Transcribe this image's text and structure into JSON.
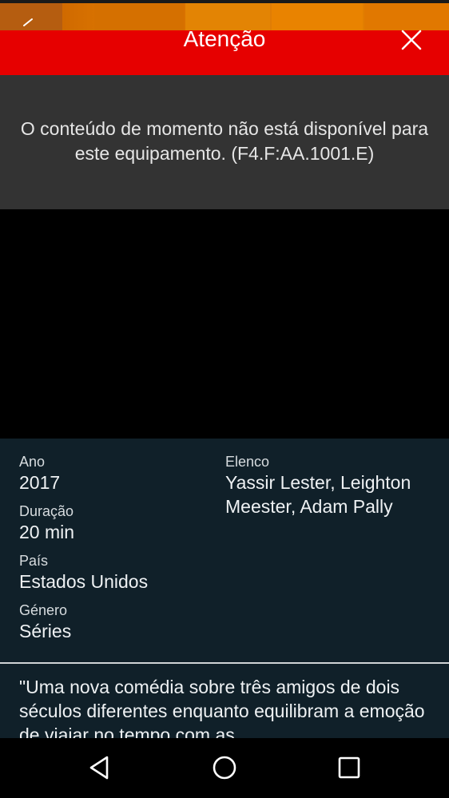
{
  "dialog": {
    "title": "Atenção",
    "message": "O conteúdo de momento não está disponível para este equipamento. (F4.F:AA.1001.E)",
    "close_icon": "close-icon",
    "header_color": "#e60000",
    "body_color": "#333333"
  },
  "details": {
    "year_label": "Ano",
    "year_value": "2017",
    "duration_label": "Duração",
    "duration_value": "20 min",
    "country_label": "País",
    "country_value": "Estados Unidos",
    "genre_label": "Género",
    "genre_value": "Séries",
    "cast_label": "Elenco",
    "cast_value": "Yassir Lester, Leighton Meester, Adam Pally",
    "synopsis": "\"Uma nova comédia sobre três amigos de dois séculos diferentes enquanto equilibram a emoção de viajar no tempo com as",
    "panel_color": "#102029"
  },
  "nav": {
    "back_icon": "nav-back-icon",
    "home_icon": "nav-home-icon",
    "recents_icon": "nav-recents-icon"
  },
  "app": {
    "back_icon": "back-arrow-icon",
    "banner_color": "#e07a00"
  }
}
